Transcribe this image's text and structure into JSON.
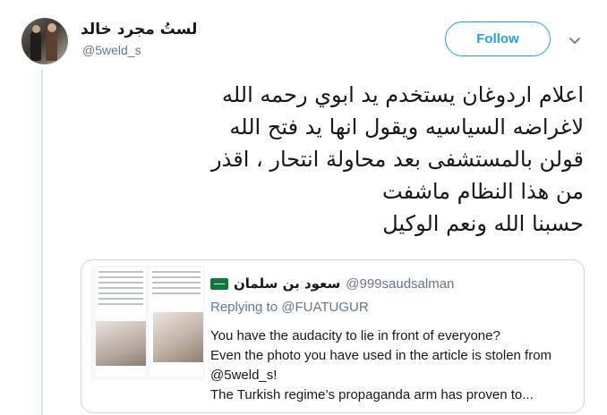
{
  "author": {
    "display_name": "لستُ مجرد خالد",
    "username": "@5weld_s"
  },
  "follow_button": {
    "label": "Follow"
  },
  "tweet": {
    "lines": [
      "اعلام اردوغان يستخدم يد ابوي رحمه الله",
      "لاغراضه السياسيه ويقول انها يد فتح الله",
      "قولن بالمستشفى بعد محاولة انتحار ، اقذر",
      "من هذا النظام ماشفت",
      "حسبنا الله ونعم الوكيل"
    ]
  },
  "quoted_tweet": {
    "display_name": "سعود بن سلمان",
    "username": "@999saudsalman",
    "replying_to_label": "Replying to",
    "replying_to_handle": "@FUATUGUR",
    "lines": [
      "You have the audacity to lie in front of everyone?",
      "Even the photo you have used in the article is stolen from",
      "@5weld_s!",
      "The Turkish regime’s propaganda arm has proven to..."
    ]
  },
  "colors": {
    "accent": "#1da1f2",
    "secondary_text": "#657786",
    "border": "#ccd6dd",
    "thread_line": "#cce8f8"
  },
  "icons": {
    "chevron": "chevron-down-icon",
    "flag": "saudi-flag-icon"
  }
}
